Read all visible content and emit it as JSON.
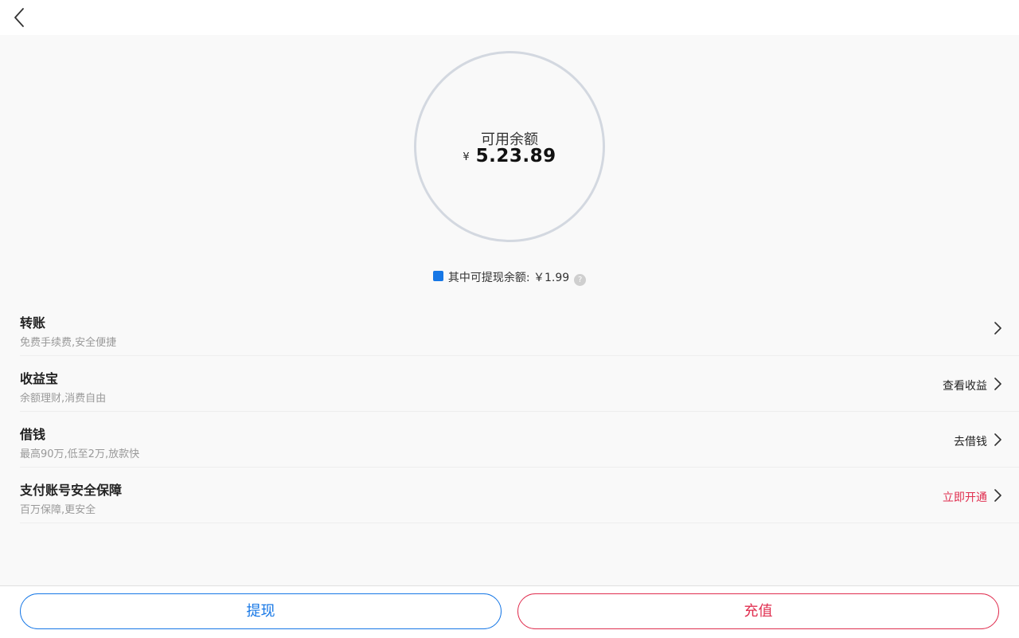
{
  "header": {
    "back_icon": "chevron-left-icon"
  },
  "balance": {
    "label": "可用余额",
    "currency": "¥",
    "amount": "5.23.89",
    "withdrawable_label": "其中可提现余额:",
    "withdrawable_amount": "￥1.99",
    "help_icon": "question-circle-icon",
    "help_glyph": "?",
    "accent_color": "#1677e6"
  },
  "list": [
    {
      "title": "转账",
      "subtitle": "免费手续费,安全便捷",
      "action": ""
    },
    {
      "title": "收益宝",
      "subtitle": "余额理财,消费自由",
      "action": "查看收益"
    },
    {
      "title": "借钱",
      "subtitle": "最高90万,低至2万,放款快",
      "action": "去借钱"
    },
    {
      "title": "支付账号安全保障",
      "subtitle": "百万保障,更安全",
      "action": "立即开通",
      "action_color": "#e02e4f"
    }
  ],
  "buttons": {
    "withdraw": "提现",
    "recharge": "充值",
    "withdraw_color": "#1677e6",
    "recharge_color": "#e02e4f"
  }
}
